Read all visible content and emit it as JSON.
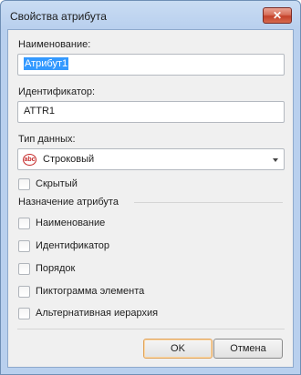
{
  "window": {
    "title": "Свойства атрибута",
    "close_symbol": "✕"
  },
  "name_field": {
    "label": "Наименование:",
    "value": "Атрибут1"
  },
  "id_field": {
    "label": "Идентификатор:",
    "value": "ATTR1"
  },
  "datatype_field": {
    "label": "Тип данных:",
    "icon": "abc-string-icon",
    "icon_text": "abc",
    "value": "Строковый"
  },
  "hidden_checkbox": {
    "label": "Скрытый",
    "checked": false
  },
  "purpose_group": {
    "title": "Назначение атрибута",
    "items": [
      {
        "label": "Наименование",
        "checked": false
      },
      {
        "label": "Идентификатор",
        "checked": false
      },
      {
        "label": "Порядок",
        "checked": false
      },
      {
        "label": "Пиктограмма элемента",
        "checked": false
      },
      {
        "label": "Альтернативная иерархия",
        "checked": false
      }
    ]
  },
  "buttons": {
    "ok": "OK",
    "cancel": "Отмена"
  }
}
